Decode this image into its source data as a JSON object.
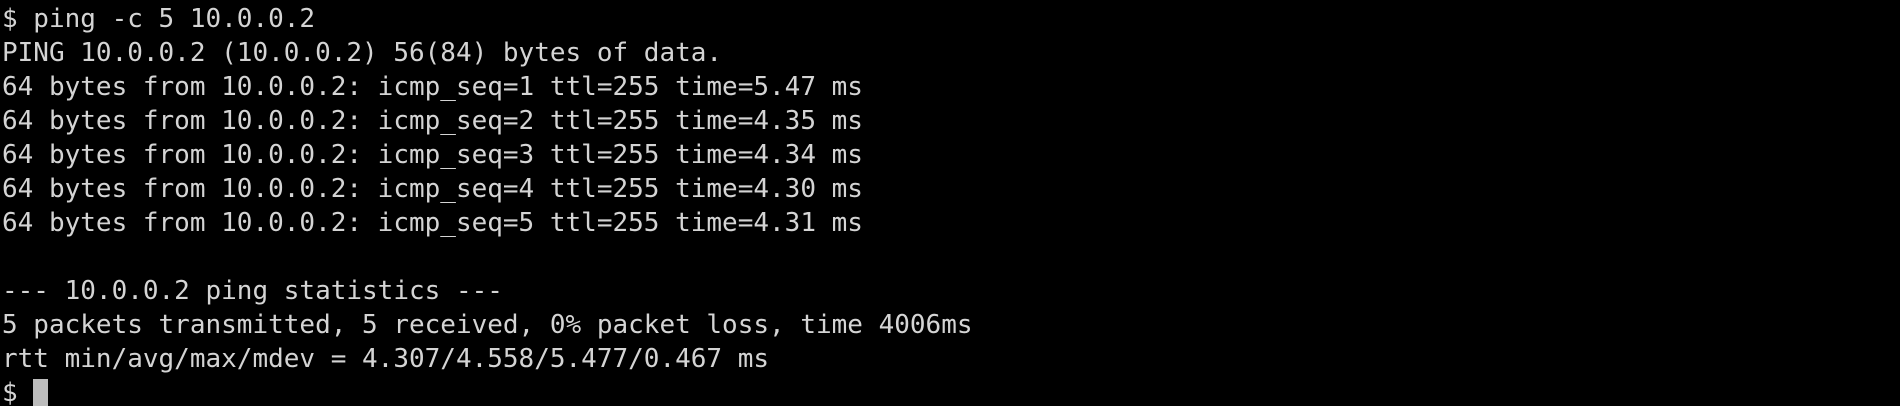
{
  "terminal": {
    "colors": {
      "background": "#000000",
      "foreground": "#d4d4d4",
      "cursor": "#bcbcbc"
    },
    "lines": [
      "$ ping -c 5 10.0.0.2",
      "PING 10.0.0.2 (10.0.0.2) 56(84) bytes of data.",
      "64 bytes from 10.0.0.2: icmp_seq=1 ttl=255 time=5.47 ms",
      "64 bytes from 10.0.0.2: icmp_seq=2 ttl=255 time=4.35 ms",
      "64 bytes from 10.0.0.2: icmp_seq=3 ttl=255 time=4.34 ms",
      "64 bytes from 10.0.0.2: icmp_seq=4 ttl=255 time=4.30 ms",
      "64 bytes from 10.0.0.2: icmp_seq=5 ttl=255 time=4.31 ms",
      "",
      "--- 10.0.0.2 ping statistics ---",
      "5 packets transmitted, 5 received, 0% packet loss, time 4006ms",
      "rtt min/avg/max/mdev = 4.307/4.558/5.477/0.467 ms"
    ],
    "prompt": "$ "
  }
}
